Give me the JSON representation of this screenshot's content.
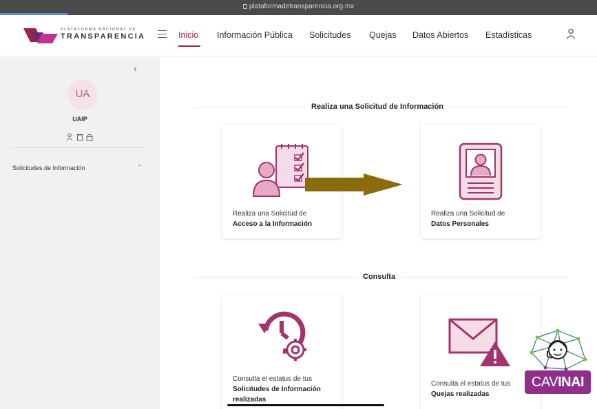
{
  "browser": {
    "url": "plataformadetransparencia.org.mx"
  },
  "logo": {
    "line1": "PLATAFORMA NACIONAL DE",
    "line2": "TRANSPARENCIA"
  },
  "nav": {
    "items": [
      {
        "label": "Inicio",
        "active": true
      },
      {
        "label": "Información Pública"
      },
      {
        "label": "Solicitudes"
      },
      {
        "label": "Quejas"
      },
      {
        "label": "Datos Abiertos"
      },
      {
        "label": "Estadísticas"
      }
    ]
  },
  "sidebar": {
    "avatar_initials": "UA",
    "user_name": "UAIP",
    "menu": [
      {
        "label": "Solicitudes de Información"
      }
    ]
  },
  "sections": {
    "solicitud": {
      "title": "Realiza una Solicitud de Información",
      "cards": [
        {
          "line1": "Realiza una Solicitud de",
          "line2": "Acceso a la Información"
        },
        {
          "line1": "Realiza una Solicitud de",
          "line2": "Datos Personales"
        }
      ]
    },
    "consulta": {
      "title": "Consulta",
      "cards": [
        {
          "line1": "Consulta el estatus de tus",
          "line2": "Solicitudes de Información",
          "line3": "realizadas"
        },
        {
          "line1": "Consulta el estatus de tus",
          "line2": "Quejas realizadas"
        }
      ]
    }
  },
  "badge": {
    "part1": "CAV",
    "part2": "INAI"
  },
  "colors": {
    "accent": "#9d2449",
    "icon_purple": "#a1336e",
    "arrow": "#8a6d0a",
    "badge": "#8e2f8a"
  }
}
